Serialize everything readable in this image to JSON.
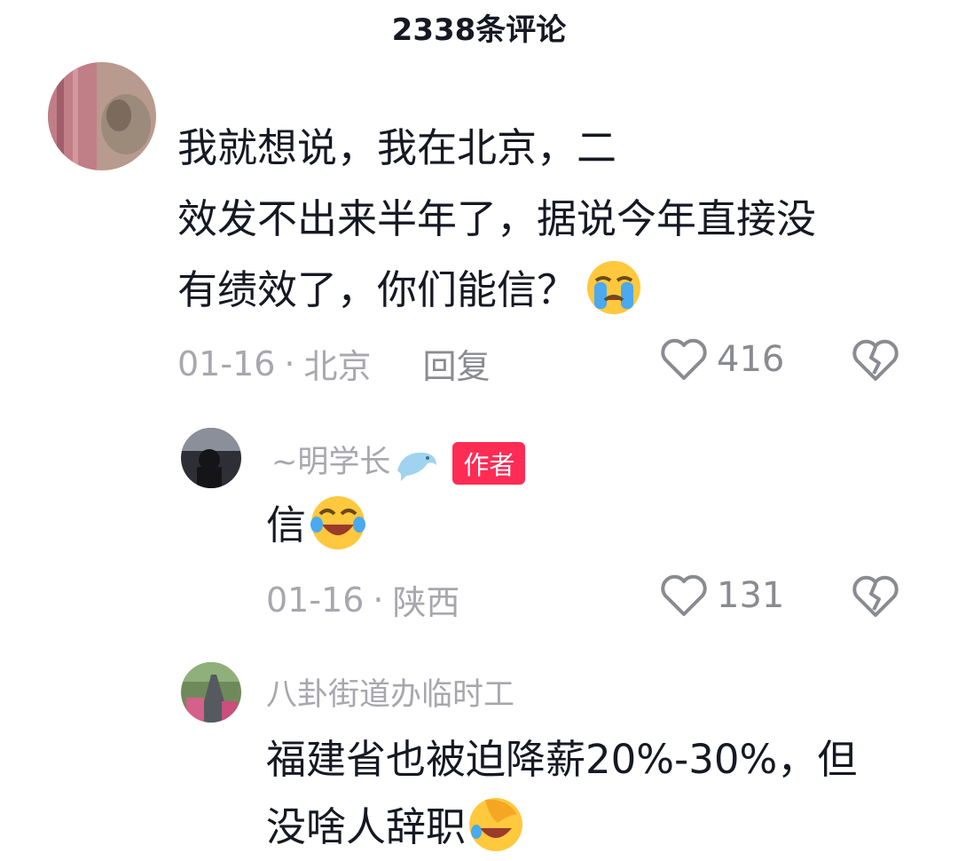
{
  "header": {
    "title": "2338条评论"
  },
  "comments": [
    {
      "username": "",
      "text_lines": [
        "我就想说，我在北京，二",
        "效发不出来半年了，据说今年直接没",
        "有绩效了，你们能信？"
      ],
      "emoji": "loudly-crying-face",
      "date": "01-16",
      "separator": "·",
      "location": "北京",
      "reply_label": "回复",
      "likes": "416"
    }
  ],
  "replies": [
    {
      "username": "~明学长",
      "username_emoji": "dolphin",
      "badge": "作者",
      "text": "信",
      "emoji": "tears-of-joy-face",
      "date": "01-16",
      "separator": "·",
      "location": "陕西",
      "likes": "131"
    },
    {
      "username": "八卦街道办临时工",
      "text_lines": [
        "福建省也被迫降薪20%-30%，但",
        "没啥人辞职"
      ],
      "emoji": "facepalm-face"
    }
  ],
  "colors": {
    "primary_text": "#161823",
    "secondary_text": "#a7a7ae",
    "badge_bg": "#fe2c55"
  }
}
